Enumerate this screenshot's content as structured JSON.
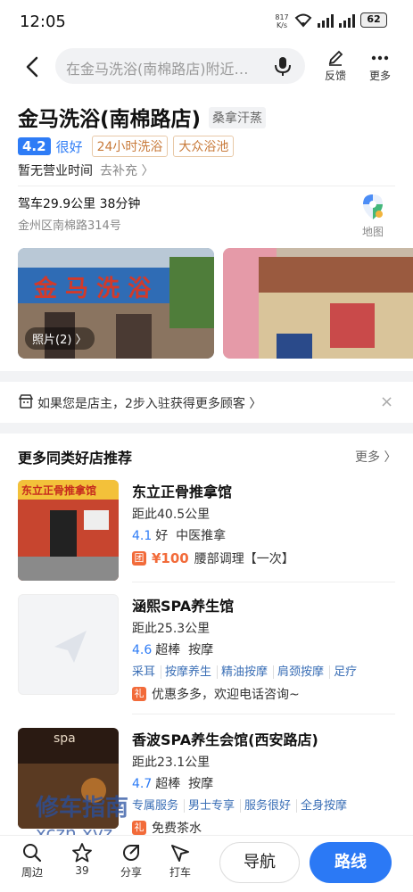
{
  "status": {
    "time": "12:05",
    "net_speed": "817",
    "net_unit": "K/s",
    "battery": "62"
  },
  "topbar": {
    "search_placeholder": "在金马洗浴(南棉路店)附近…",
    "feedback_label": "反馈",
    "more_label": "更多"
  },
  "place": {
    "name": "金马洗浴(南棉路店)",
    "category": "桑拿汗蒸",
    "score": "4.2",
    "score_text": "很好",
    "tags": [
      "24小时洗浴",
      "大众浴池"
    ],
    "hours": "暂无营业时间",
    "hours_action": "去补充 〉",
    "drive": "驾车29.9公里 38分钟",
    "address": "金州区南棉路314号",
    "map_label": "地图",
    "photo_label": "照片(2) 〉",
    "photo_sign_text": "金 马 洗 浴"
  },
  "owner_bar": {
    "text": "如果您是店主，2步入驻获得更多顾客 〉",
    "close": "×"
  },
  "recommend": {
    "title": "更多同类好店推荐",
    "more": "更多 〉",
    "shops": [
      {
        "name": "东立正骨推拿馆",
        "distance": "距此40.5公里",
        "score": "4.1",
        "score_text": "好",
        "category": "中医推拿",
        "promo_icon": "团",
        "price": "¥100",
        "promo_text": "腰部调理【一次】",
        "thumb_sign": "东立正骨推拿馆"
      },
      {
        "name": "涵熙SPA养生馆",
        "distance": "距此25.3公里",
        "score": "4.6",
        "score_text": "超棒",
        "category": "按摩",
        "tags": [
          "采耳",
          "按摩养生",
          "精油按摩",
          "肩颈按摩",
          "足疗"
        ],
        "promo_icon": "礼",
        "promo_text": "优惠多多，欢迎电话咨询~"
      },
      {
        "name": "香波SPA养生会馆(西安路店)",
        "distance": "距此23.1公里",
        "score": "4.7",
        "score_text": "超棒",
        "category": "按摩",
        "tags": [
          "专属服务",
          "男士专享",
          "服务很好",
          "全身按摩"
        ],
        "promo_icon": "礼",
        "promo_text": "免费茶水",
        "thumb_text": "spa"
      }
    ]
  },
  "watermark": {
    "line1": "修车指南",
    "line2": "xczn.xyz"
  },
  "bottombar": {
    "nearby": "周边",
    "favorites": "39",
    "share": "分享",
    "taxi": "打车",
    "navigate": "导航",
    "route": "路线"
  }
}
